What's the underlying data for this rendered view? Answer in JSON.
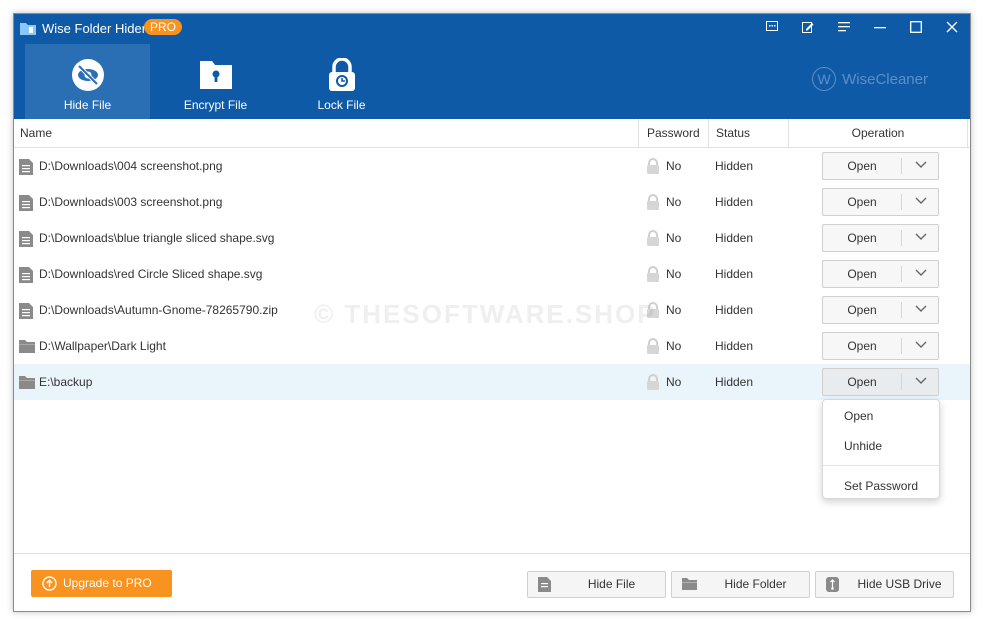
{
  "app": {
    "title": "Wise Folder Hider",
    "badge": "PRO"
  },
  "titlebar_icons": [
    "feedback-icon",
    "edit-icon",
    "menu-icon",
    "minimize-icon",
    "maximize-icon",
    "close-icon"
  ],
  "nav": {
    "tabs": [
      {
        "label": "Hide File",
        "icon": "eye-slash-icon",
        "active": true
      },
      {
        "label": "Encrypt File",
        "icon": "folder-keyhole-icon",
        "active": false
      },
      {
        "label": "Lock File",
        "icon": "lock-icon",
        "active": false
      }
    ]
  },
  "brand": {
    "logo_letter": "W",
    "name": "WiseCleaner"
  },
  "table": {
    "columns": {
      "name": "Name",
      "password": "Password",
      "status": "Status",
      "operation": "Operation"
    },
    "rows": [
      {
        "name": "D:\\Downloads\\004  screenshot.png",
        "type": "file",
        "password": "No",
        "status": "Hidden",
        "action": "Open"
      },
      {
        "name": "D:\\Downloads\\003  screenshot.png",
        "type": "file",
        "password": "No",
        "status": "Hidden",
        "action": "Open"
      },
      {
        "name": "D:\\Downloads\\blue triangle sliced shape.svg",
        "type": "file",
        "password": "No",
        "status": "Hidden",
        "action": "Open"
      },
      {
        "name": "D:\\Downloads\\red Circle Sliced shape.svg",
        "type": "file",
        "password": "No",
        "status": "Hidden",
        "action": "Open"
      },
      {
        "name": "D:\\Downloads\\Autumn-Gnome-78265790.zip",
        "type": "file",
        "password": "No",
        "status": "Hidden",
        "action": "Open"
      },
      {
        "name": "D:\\Wallpaper\\Dark Light",
        "type": "folder",
        "password": "No",
        "status": "Hidden",
        "action": "Open"
      },
      {
        "name": "E:\\backup",
        "type": "folder",
        "password": "No",
        "status": "Hidden",
        "action": "Open",
        "selected": true
      }
    ]
  },
  "dropdown_menu": {
    "items": [
      "Open",
      "Unhide",
      "Set Password"
    ]
  },
  "footer": {
    "upgrade_label": "Upgrade to PRO",
    "hide_file_label": "Hide File",
    "hide_folder_label": "Hide Folder",
    "hide_usb_label": "Hide USB Drive"
  },
  "watermark": "© THESOFTWARE.SHOP",
  "colors": {
    "header_bg": "#0e5aa7",
    "active_tab": "#2a6fb4",
    "accent_orange": "#f7931e",
    "selected_row": "#eaf4fb"
  }
}
